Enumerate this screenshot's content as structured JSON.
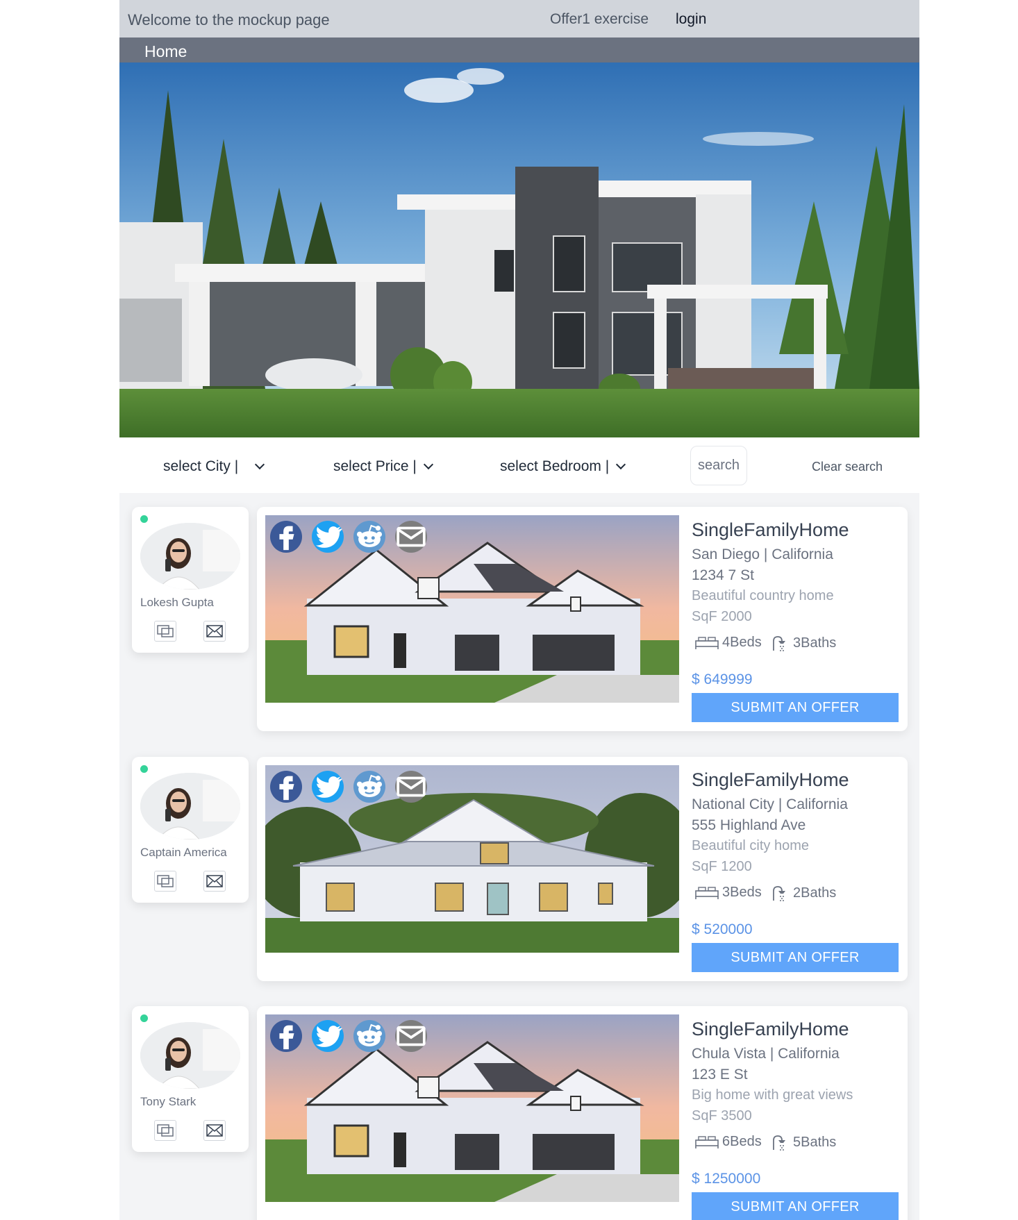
{
  "header": {
    "welcome": "Welcome to the mockup page",
    "offer_link": "Offer1 exercise",
    "login_link": "login"
  },
  "nav": {
    "home": "Home"
  },
  "filters": {
    "city": "select City |",
    "price": "select Price |",
    "bedroom": "select Bedroom |",
    "search_placeholder": "search",
    "clear": "Clear search"
  },
  "listings": [
    {
      "agent": {
        "name": "Lokesh Gupta",
        "status": "online"
      },
      "type": "SingleFamilyHome",
      "location": "San Diego | California",
      "street": "1234 7 St",
      "description": "Beautiful country home",
      "sqf": "SqF 2000",
      "beds": "4Beds",
      "baths": "3Baths",
      "price": "$ 649999",
      "cta": "SUBMIT AN OFFER"
    },
    {
      "agent": {
        "name": "Captain America",
        "status": "online"
      },
      "type": "SingleFamilyHome",
      "location": "National City | California",
      "street": "555 Highland Ave",
      "description": "Beautiful city home",
      "sqf": "SqF 1200",
      "beds": "3Beds",
      "baths": "2Baths",
      "price": "$ 520000",
      "cta": "SUBMIT AN OFFER"
    },
    {
      "agent": {
        "name": "Tony Stark",
        "status": "online"
      },
      "type": "SingleFamilyHome",
      "location": "Chula Vista | California",
      "street": "123 E St",
      "description": "Big home with great views",
      "sqf": "SqF 3500",
      "beds": "6Beds",
      "baths": "5Baths",
      "price": "$ 1250000",
      "cta": "SUBMIT AN OFFER"
    }
  ],
  "icons": {
    "social": [
      "facebook-icon",
      "twitter-icon",
      "reddit-icon",
      "email-icon"
    ],
    "agent_actions": [
      "chat-icon",
      "mail-icon"
    ],
    "features": [
      "bed-icon",
      "shower-icon"
    ],
    "filters": "chevron-down-icon"
  },
  "colors": {
    "topbar": "#d1d5db",
    "homebar": "#6b7280",
    "accent": "#60a5fa",
    "price": "#5b93e6",
    "online": "#34d399",
    "facebook": "#3b5998",
    "twitter": "#1da1f2",
    "reddit": "#5f99cf",
    "email": "#7d7d7d"
  }
}
